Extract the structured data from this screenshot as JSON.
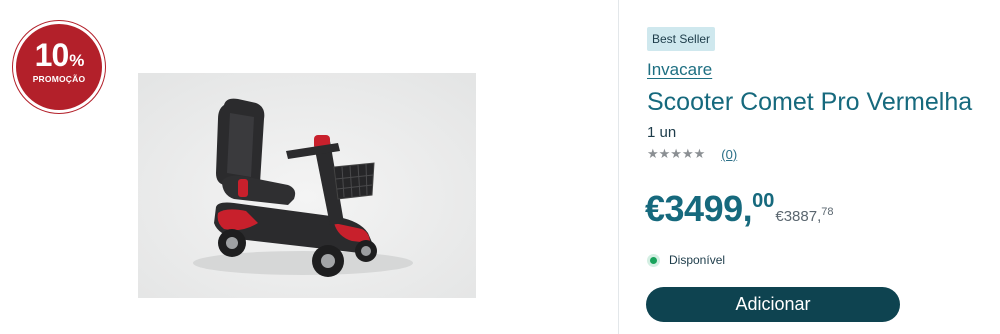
{
  "promo": {
    "percent": "10",
    "percent_sign": "%",
    "label": "PROMOÇÃO"
  },
  "product": {
    "image_name": "scooter-comet-pro-photo",
    "badge": "Best Seller",
    "brand": "Invacare",
    "title": "Scooter Comet Pro Vermelha",
    "unit": "1 un",
    "stars": "★★★★★",
    "rating_stars": 0,
    "review_count": "(0)",
    "price": {
      "currency_whole": "€3499,",
      "cents": "00"
    },
    "old_price": {
      "currency_whole": "€3887,",
      "cents": "78"
    },
    "availability": "Disponível",
    "add_label": "Adicionar"
  },
  "colors": {
    "accent": "#16697d",
    "button": "#0e4350",
    "promo": "#b3202a",
    "badge_bg": "#cfe8ee",
    "available": "#19a35c"
  }
}
